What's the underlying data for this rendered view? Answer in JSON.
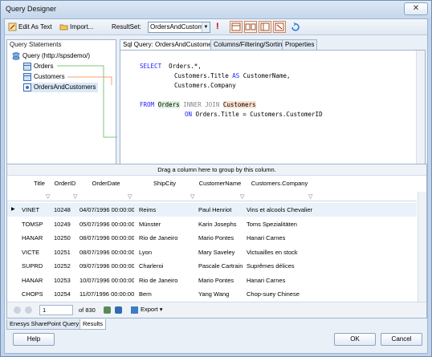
{
  "window": {
    "title": "Query Designer",
    "close_label": "✕"
  },
  "toolbar": {
    "edit_as_text_label": "Edit As Text",
    "import_label": "Import...",
    "resultset_label": "ResultSet:",
    "resultset_value": "OrdersAndCustom",
    "run_label": "!"
  },
  "query_statements": {
    "header": "Query Statements",
    "root": "Query (http://spsdemo/)",
    "items": [
      "Orders",
      "Customers",
      "OrdersAndCustomers"
    ]
  },
  "tabs": [
    "Sql Query: OrdersAndCustomers",
    "Columns/Filtering/Sorting",
    "Properties"
  ],
  "sql": {
    "line1_kw": "SELECT",
    "line1": "Orders.*,",
    "line2_a": "Customers.Title ",
    "line2_kw": "AS",
    "line2_b": " CustomerName,",
    "line3": "Customers.Company",
    "line4_kw": "FROM",
    "line4_a": "Orders",
    "line4_kw2": " INNER JOIN ",
    "line4_b": "Customers",
    "line5_kw": "ON",
    "line5": " Orders.Title = Customers.CustomerID"
  },
  "grid": {
    "group_hint": "Drag a column here to group by this column.",
    "columns": [
      "Title",
      "OrderID",
      "OrderDate",
      "ShipCity",
      "CustomerName",
      "Customers.Company"
    ],
    "rows": [
      [
        "VINET",
        "10248",
        "04/07/1996 00:00:00",
        "Reims",
        "Paul Henriot",
        "Vins et alcools Chevalier"
      ],
      [
        "TOMSP",
        "10249",
        "05/07/1996 00:00:00",
        "Münster",
        "Karin Josephs",
        "Toms Spezialitäten"
      ],
      [
        "HANAR",
        "10250",
        "08/07/1996 00:00:00",
        "Rio de Janeiro",
        "Mario Pontes",
        "Hanari Carnes"
      ],
      [
        "VICTE",
        "10251",
        "08/07/1996 00:00:00",
        "Lyon",
        "Mary Saveley",
        "Victuailles en stock"
      ],
      [
        "SUPRD",
        "10252",
        "09/07/1996 00:00:00",
        "Charleroi",
        "Pascale Cartrain",
        "Suprêmes délices"
      ],
      [
        "HANAR",
        "10253",
        "10/07/1996 00:00:00",
        "Rio de Janeiro",
        "Mario Pontes",
        "Hanari Carnes"
      ],
      [
        "CHOPS",
        "10254",
        "11/07/1996 00:00:00",
        "Bern",
        "Yang Wang",
        "Chop-suey Chinese"
      ]
    ]
  },
  "pager": {
    "page": "1",
    "of": "of 830",
    "export_label": "Export"
  },
  "bottom_tabs": [
    "Enesys SharePoint Query",
    "Results"
  ],
  "buttons": {
    "help": "Help",
    "ok": "OK",
    "cancel": "Cancel"
  }
}
